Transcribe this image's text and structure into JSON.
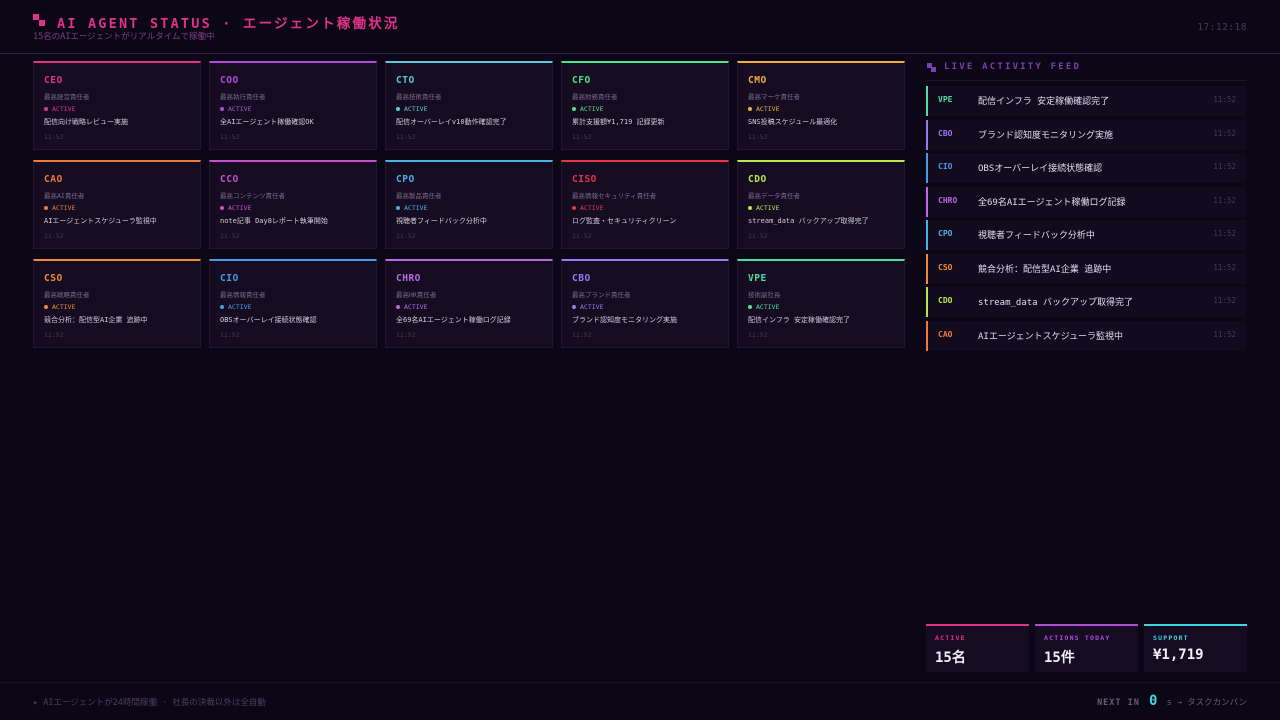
{
  "header": {
    "title": "AI AGENT STATUS · エージェント稼働状況",
    "subtitle": "15名のAIエージェントがリアルタイムで稼働中",
    "clock": "17:12:18"
  },
  "agents": [
    {
      "role": "CEO",
      "title_jp": "最高経営責任者",
      "status": "ACTIVE",
      "task": "配信向け戦略レビュー実施",
      "time": "11:52",
      "color": "#e0328a"
    },
    {
      "role": "COO",
      "title_jp": "最高執行責任者",
      "status": "ACTIVE",
      "task": "全AIエージェント稼働確認OK",
      "time": "11:52",
      "color": "#b04bd8"
    },
    {
      "role": "CTO",
      "title_jp": "最高技術責任者",
      "status": "ACTIVE",
      "task": "配信オーバーレイv10動作確認完了",
      "time": "11:52",
      "color": "#5ec8d8"
    },
    {
      "role": "CFO",
      "title_jp": "最高財務責任者",
      "status": "ACTIVE",
      "task": "累計支援額¥1,719 記録更新",
      "time": "11:52",
      "color": "#4ee08a"
    },
    {
      "role": "CMO",
      "title_jp": "最高マーケ責任者",
      "status": "ACTIVE",
      "task": "SNS投稿スケジュール最適化",
      "time": "11:52",
      "color": "#f0b03a"
    },
    {
      "role": "CAO",
      "title_jp": "最高AI責任者",
      "status": "ACTIVE",
      "task": "AIエージェントスケジューラ監視中",
      "time": "11:52",
      "color": "#f07a3a"
    },
    {
      "role": "CCO",
      "title_jp": "最高コンテンツ責任者",
      "status": "ACTIVE",
      "task": "note記事 Day8レポート執筆開始",
      "time": "11:52",
      "color": "#c94fd0"
    },
    {
      "role": "CPO",
      "title_jp": "最高製品責任者",
      "status": "ACTIVE",
      "task": "視聴者フィードバック分析中",
      "time": "11:52",
      "color": "#4ab0e8"
    },
    {
      "role": "CISO",
      "title_jp": "最高情報セキュリティ責任者",
      "status": "ACTIVE",
      "task": "ログ監査・セキュリティクリーン",
      "time": "11:52",
      "color": "#e8324a"
    },
    {
      "role": "CDO",
      "title_jp": "最高データ責任者",
      "status": "ACTIVE",
      "task": "stream_data バックアップ取得完了",
      "time": "11:52",
      "color": "#b8e84a"
    },
    {
      "role": "CSO",
      "title_jp": "最高戦略責任者",
      "status": "ACTIVE",
      "task": "競合分析：配信型AI企業 追跡中",
      "time": "11:52",
      "color": "#f08a3a"
    },
    {
      "role": "CIO",
      "title_jp": "最高情報責任者",
      "status": "ACTIVE",
      "task": "OBSオーバーレイ接続状態確認",
      "time": "11:52",
      "color": "#4a9ae8"
    },
    {
      "role": "CHRO",
      "title_jp": "最高HR責任者",
      "status": "ACTIVE",
      "task": "全69名AIエージェント稼働ログ記録",
      "time": "11:52",
      "color": "#b86ae0"
    },
    {
      "role": "CBO",
      "title_jp": "最高ブランド責任者",
      "status": "ACTIVE",
      "task": "ブランド認知度モニタリング実施",
      "time": "11:52",
      "color": "#9a7af0"
    },
    {
      "role": "VPE",
      "title_jp": "技術副社長",
      "status": "ACTIVE",
      "task": "配信インフラ 安定稼働確認完了",
      "time": "11:52",
      "color": "#4ee0a0"
    }
  ],
  "feed": {
    "title": "LIVE ACTIVITY FEED",
    "items": [
      {
        "role": "VPE",
        "text": "配信インフラ 安定稼働確認完了",
        "time": "11:52",
        "color": "#4ee0a0"
      },
      {
        "role": "CBO",
        "text": "ブランド認知度モニタリング実施",
        "time": "11:52",
        "color": "#9a7af0"
      },
      {
        "role": "CIO",
        "text": "OBSオーバーレイ接続状態確認",
        "time": "11:52",
        "color": "#4a9ae8"
      },
      {
        "role": "CHRO",
        "text": "全69名AIエージェント稼働ログ記録",
        "time": "11:52",
        "color": "#b86ae0"
      },
      {
        "role": "CPO",
        "text": "視聴者フィードバック分析中",
        "time": "11:52",
        "color": "#4ab0e8"
      },
      {
        "role": "CSO",
        "text": "競合分析：配信型AI企業 追跡中",
        "time": "11:52",
        "color": "#f08a3a"
      },
      {
        "role": "CDO",
        "text": "stream_data バックアップ取得完了",
        "time": "11:52",
        "color": "#b8e84a"
      },
      {
        "role": "CAO",
        "text": "AIエージェントスケジューラ監視中",
        "time": "11:52",
        "color": "#f07a3a"
      }
    ]
  },
  "stats": [
    {
      "label": "ACTIVE",
      "value": "15名",
      "color": "#e0328a"
    },
    {
      "label": "ACTIONS TODAY",
      "value": "15件",
      "color": "#b04bd8"
    },
    {
      "label": "SUPPORT",
      "value": "¥1,719",
      "color": "#3fd6e0"
    }
  ],
  "footer": {
    "left": "▸ AIエージェントが24時間稼働 · 社長の決裁以外は全自動",
    "next_label": "NEXT IN",
    "countdown": "0",
    "unit": "s →",
    "next_target": "タスクカンバン"
  }
}
